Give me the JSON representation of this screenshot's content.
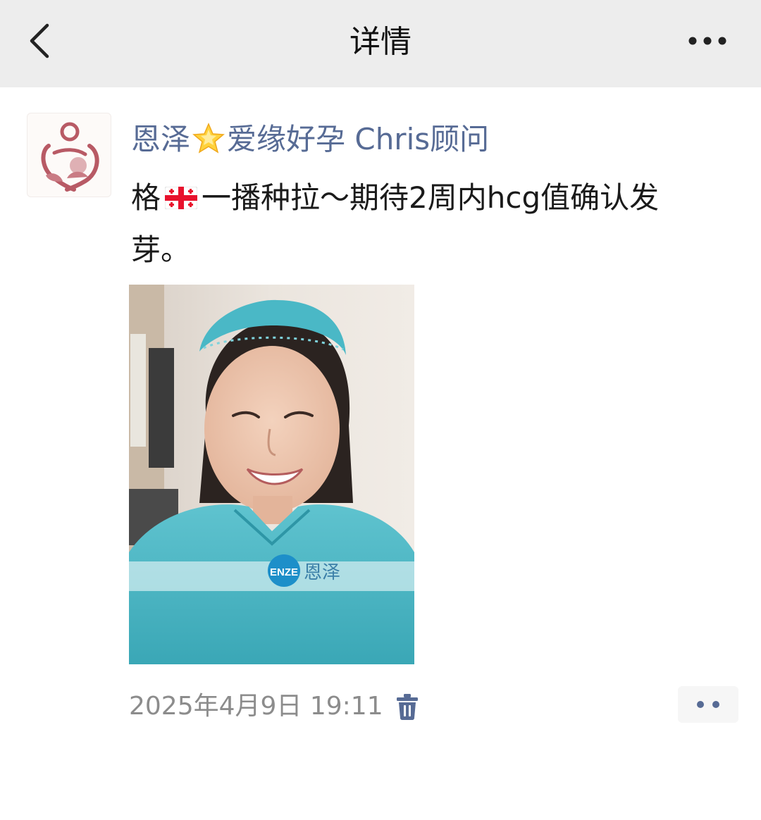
{
  "header": {
    "title": "详情",
    "back_icon": "chevron-left-icon",
    "more_icon": "more-horizontal-icon"
  },
  "post": {
    "author": {
      "name_part1": "恩泽",
      "name_part2": "爱缘好孕 Chris顾问",
      "emoji": "star-emoji-icon"
    },
    "text": {
      "part1": "格",
      "part2": "一播种拉～期待2周内hcg值确认发芽。",
      "flag": "georgia-flag-icon"
    },
    "image": {
      "watermark_badge": "ENZE",
      "watermark_text": "恩泽"
    },
    "timestamp": "2025年4月9日 19:11",
    "delete_icon": "trash-icon",
    "action_icon": "comment-more-icon"
  },
  "colors": {
    "topbar_bg": "#ededed",
    "author_link": "#576b95",
    "timestamp": "#8c8c8c",
    "logo": "#b85a65"
  }
}
